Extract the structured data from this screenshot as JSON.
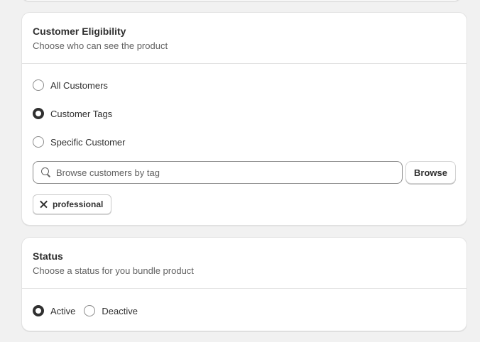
{
  "eligibility": {
    "title": "Customer Eligibility",
    "subtitle": "Choose who can see the product",
    "options": [
      {
        "label": "All Customers",
        "checked": false
      },
      {
        "label": "Customer Tags",
        "checked": true
      },
      {
        "label": "Specific Customer",
        "checked": false
      }
    ],
    "search": {
      "placeholder": "Browse customers by tag",
      "value": ""
    },
    "browse_label": "Browse",
    "tags": [
      {
        "label": "professional"
      }
    ]
  },
  "status": {
    "title": "Status",
    "subtitle": "Choose a status for you bundle product",
    "options": [
      {
        "label": "Active",
        "checked": true
      },
      {
        "label": "Deactive",
        "checked": false
      }
    ]
  },
  "colors": {
    "background": "#f1f1f1",
    "card": "#ffffff",
    "text": "#303030",
    "muted": "#616161",
    "border": "#e3e3e3"
  },
  "icons": {
    "search": "search-icon",
    "remove_tag": "close-icon",
    "radio": "radio-button"
  }
}
